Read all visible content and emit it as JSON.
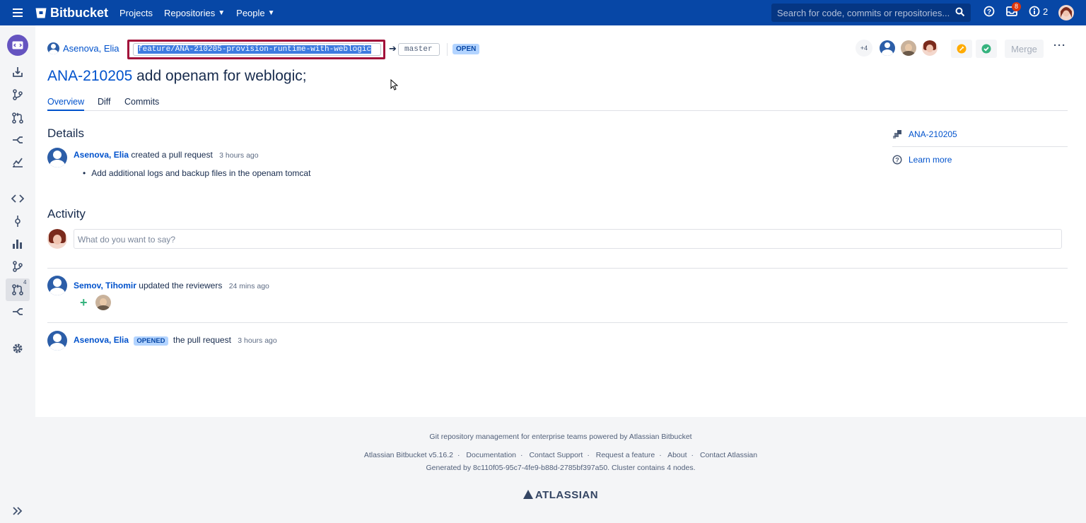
{
  "topbar": {
    "brand": "Bitbucket",
    "nav": [
      {
        "label": "Projects",
        "has_caret": false
      },
      {
        "label": "Repositories",
        "has_caret": true
      },
      {
        "label": "People",
        "has_caret": true
      }
    ],
    "search_placeholder": "Search for code, commits or repositories...",
    "inbox_count": "8",
    "info_count": "2",
    "colors": {
      "bar": "#0747a6",
      "badge": "#de350b"
    }
  },
  "pr": {
    "author": "Asenova, Elia",
    "from_branch": "feature/ANA-210205-provision-runtime-with-weblogic",
    "to_branch": "master",
    "state": "OPEN",
    "id": "ANA-210205",
    "title": "add openam for weblogic;",
    "reviewers_more": "+4",
    "merge_label": "Merge"
  },
  "tabs": [
    {
      "label": "Overview",
      "active": true
    },
    {
      "label": "Diff",
      "active": false
    },
    {
      "label": "Commits",
      "active": false
    }
  ],
  "details": {
    "heading": "Details",
    "author": "Asenova, Elia",
    "action": "created a pull request",
    "time": "3 hours ago",
    "bullet": "Add additional logs and backup files in the openam tomcat"
  },
  "right_panel": {
    "jira_issue": "ANA-210205",
    "learn_more": "Learn more"
  },
  "activity": {
    "heading": "Activity",
    "comment_placeholder": "What do you want to say?",
    "items": [
      {
        "author": "Semov, Tihomir",
        "action": "updated the reviewers",
        "time": "24 mins ago"
      },
      {
        "author": "Asenova, Elia",
        "lozenge": "OPENED",
        "action": "the pull request",
        "time": "3 hours ago"
      }
    ]
  },
  "sidebar": {
    "pr_count": "4"
  },
  "footer": {
    "tagline": "Git repository management for enterprise teams powered by Atlassian Bitbucket",
    "links": [
      "Atlassian Bitbucket v5.16.2",
      "Documentation",
      "Contact Support",
      "Request a feature",
      "About",
      "Contact Atlassian"
    ],
    "generated": "Generated by 8c110f05-95c7-4fe9-b88d-2785bf397a50. Cluster contains 4 nodes.",
    "brand": "ATLASSIAN"
  }
}
